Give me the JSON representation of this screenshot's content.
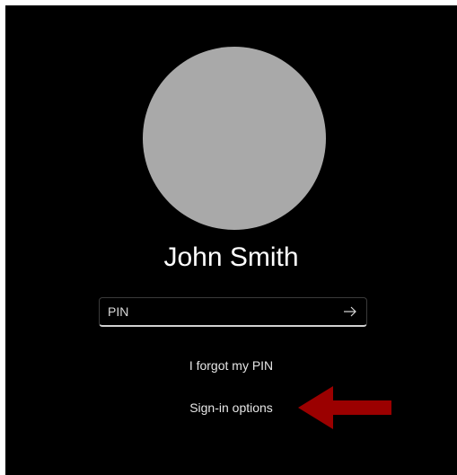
{
  "lock_screen": {
    "user_name": "John Smith",
    "pin_placeholder": "PIN",
    "submit_icon": "arrow-right-icon",
    "forgot_pin_label": "I forgot my PIN",
    "sign_in_options_label": "Sign-in options"
  },
  "annotation": {
    "pointer_icon": "red-arrow-icon",
    "pointer_color": "#9b0000"
  },
  "colors": {
    "background": "#000000",
    "avatar": "#a9a9a9",
    "text": "#ffffff"
  }
}
